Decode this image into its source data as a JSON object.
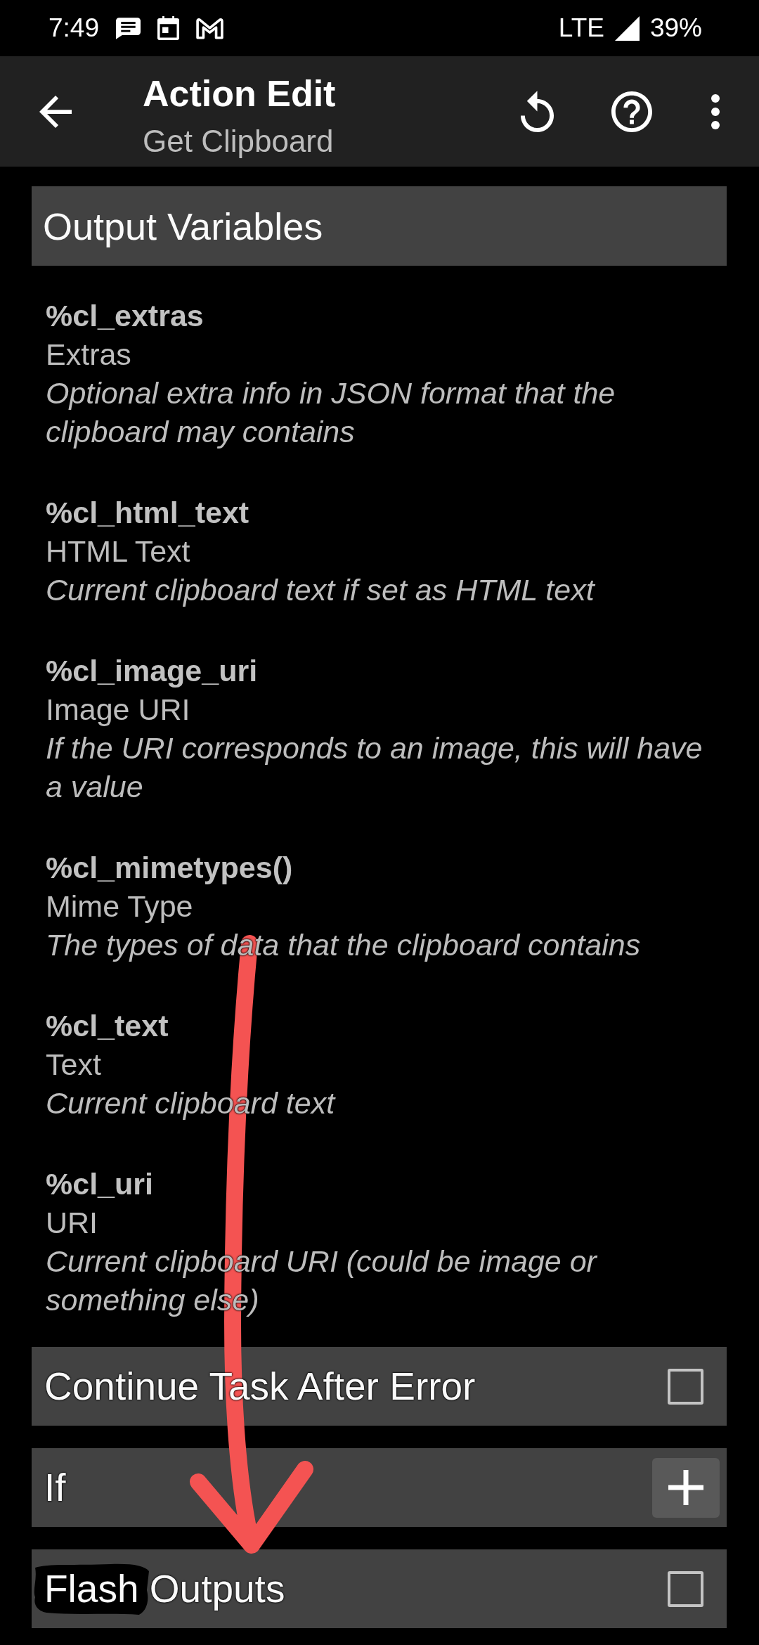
{
  "status_bar": {
    "time": "7:49",
    "network": "LTE",
    "battery": "39%"
  },
  "toolbar": {
    "title": "Action Edit",
    "subtitle": "Get Clipboard"
  },
  "output_variables": {
    "title": "Output Variables",
    "items": [
      {
        "name": "%cl_extras",
        "label": "Extras",
        "description": "Optional extra info in JSON format that the clipboard may contains"
      },
      {
        "name": "%cl_html_text",
        "label": "HTML Text",
        "description": "Current clipboard text if set as HTML text"
      },
      {
        "name": "%cl_image_uri",
        "label": "Image URI",
        "description": "If the URI corresponds to an image, this will have a value"
      },
      {
        "name": "%cl_mimetypes()",
        "label": "Mime Type",
        "description": "The types of data that the clipboard contains"
      },
      {
        "name": "%cl_text",
        "label": "Text",
        "description": "Current clipboard text"
      },
      {
        "name": "%cl_uri",
        "label": "URI",
        "description": "Current clipboard URI (could be image or something else)"
      }
    ]
  },
  "options": [
    {
      "kind": "checkbox",
      "label": "Continue Task After Error",
      "checked": false,
      "marked": false
    },
    {
      "kind": "add",
      "label": "If",
      "marked": false
    },
    {
      "kind": "checkbox",
      "label": "Flash Outputs",
      "checked": false,
      "marked": true
    }
  ],
  "annotations": [
    {
      "kind": "arrow"
    }
  ]
}
